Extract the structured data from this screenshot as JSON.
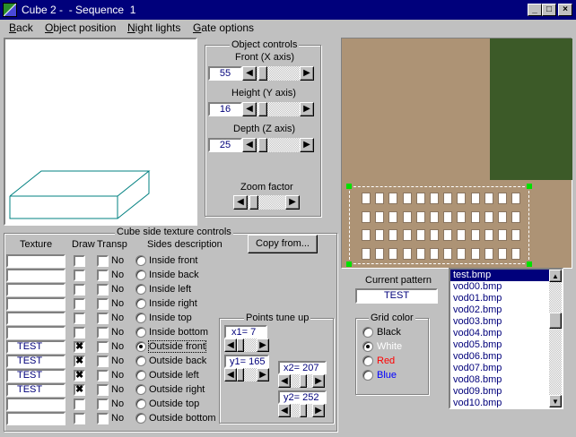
{
  "window": {
    "title": "Cube 2 -  - Sequence  1",
    "min": "_",
    "max": "□",
    "close": "×"
  },
  "menu": [
    {
      "label": "Back",
      "ul": "B",
      "rest": "ack"
    },
    {
      "label": "Object position",
      "ul": "O",
      "rest": "bject position"
    },
    {
      "label": "Night lights",
      "ul": "N",
      "rest": "ight lights"
    },
    {
      "label": "Gate options",
      "ul": "G",
      "rest": "ate options"
    }
  ],
  "object_controls": {
    "title": "Object controls",
    "front_label": "Front (X axis)",
    "front_value": "55",
    "height_label": "Height (Y axis)",
    "height_value": "16",
    "depth_label": "Depth (Z axis)",
    "depth_value": "25",
    "zoom_label": "Zoom factor"
  },
  "texture_controls": {
    "title": "Cube side texture controls",
    "col_texture": "Texture",
    "col_draw": "Draw",
    "col_transp": "Transp",
    "col_sides": "Sides description",
    "copy_button": "Copy from...",
    "rows": [
      {
        "texture": "",
        "draw": "",
        "no": "No",
        "side": "Inside front",
        "selected": false
      },
      {
        "texture": "",
        "draw": "",
        "no": "No",
        "side": "Inside back",
        "selected": false
      },
      {
        "texture": "",
        "draw": "",
        "no": "No",
        "side": "Inside left",
        "selected": false
      },
      {
        "texture": "",
        "draw": "",
        "no": "No",
        "side": "Inside right",
        "selected": false
      },
      {
        "texture": "",
        "draw": "",
        "no": "No",
        "side": "Inside top",
        "selected": false
      },
      {
        "texture": "",
        "draw": "",
        "no": "No",
        "side": "Inside bottom",
        "selected": false
      },
      {
        "texture": "TEST",
        "draw": "✖",
        "no": "No",
        "side": "Outside front",
        "selected": true
      },
      {
        "texture": "TEST",
        "draw": "✖",
        "no": "No",
        "side": "Outside back",
        "selected": false
      },
      {
        "texture": "TEST",
        "draw": "✖",
        "no": "No",
        "side": "Outside left",
        "selected": false
      },
      {
        "texture": "TEST",
        "draw": "✖",
        "no": "No",
        "side": "Outside right",
        "selected": false
      },
      {
        "texture": "",
        "draw": "",
        "no": "No",
        "side": "Outside top",
        "selected": false
      },
      {
        "texture": "",
        "draw": "",
        "no": "No",
        "side": "Outside bottom",
        "selected": false
      }
    ]
  },
  "points": {
    "title": "Points tune up",
    "x1": "x1= 7",
    "y1": "y1= 165",
    "x2": "x2= 207",
    "y2": "y2= 252"
  },
  "pattern": {
    "label": "Current pattern",
    "value": "TEST"
  },
  "grid_color": {
    "title": "Grid color",
    "options": [
      {
        "label": "Black",
        "color": "#000000",
        "selected": false
      },
      {
        "label": "White",
        "color": "#ffffff",
        "selected": true
      },
      {
        "label": "Red",
        "color": "#ff0000",
        "selected": false
      },
      {
        "label": "Blue",
        "color": "#0000ff",
        "selected": false
      }
    ]
  },
  "files": [
    "test.bmp",
    "vod00.bmp",
    "vod01.bmp",
    "vod02.bmp",
    "vod03.bmp",
    "vod04.bmp",
    "vod05.bmp",
    "vod06.bmp",
    "vod07.bmp",
    "vod08.bmp",
    "vod09.bmp",
    "vod10.bmp"
  ],
  "files_selected": 0,
  "colors": {
    "texture_bg": "#ad9375",
    "texture_green": "#3c5a28",
    "cube_line": "#008080",
    "selection": "#00007b"
  }
}
